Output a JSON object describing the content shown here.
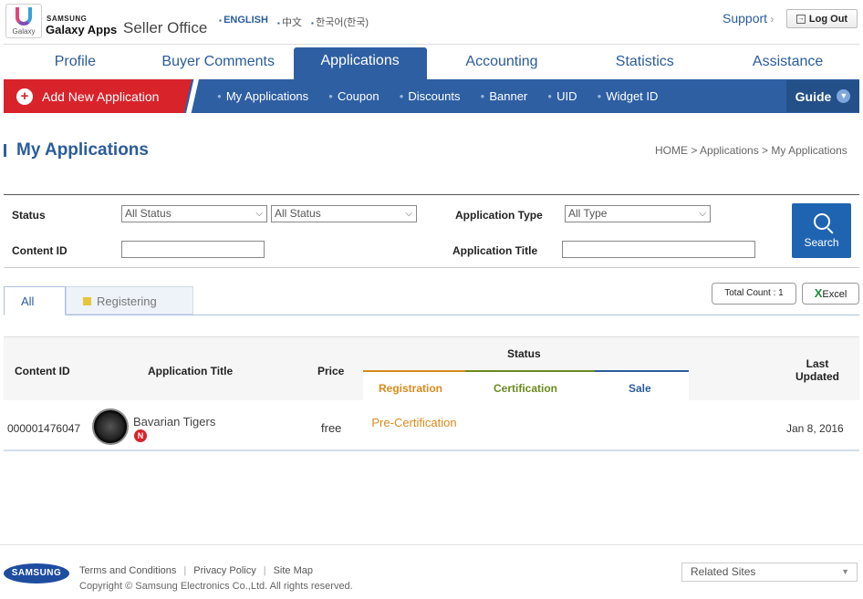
{
  "header": {
    "logo_text": "Galaxy",
    "brand_small": "SAMSUNG",
    "brand_big": "Galaxy Apps",
    "brand_office": "Seller Office",
    "languages": [
      "ENGLISH",
      "中文",
      "한국어(한국)"
    ],
    "support": "Support",
    "logout": "Log Out"
  },
  "main_nav": {
    "tabs": [
      "Profile",
      "Buyer Comments",
      "Applications",
      "Accounting",
      "Statistics",
      "Assistance"
    ],
    "active": "Applications"
  },
  "sub_nav": {
    "add_new": "Add New Application",
    "items": [
      "My Applications",
      "Coupon",
      "Discounts",
      "Banner",
      "UID",
      "Widget ID"
    ],
    "guide": "Guide"
  },
  "page": {
    "title": "My Applications",
    "breadcrumb": "HOME  >  Applications  >  My Applications"
  },
  "search": {
    "status_label": "Status",
    "status_select1": "All Status",
    "status_select2": "All Status",
    "app_type_label": "Application Type",
    "app_type_select": "All Type",
    "content_id_label": "Content ID",
    "content_id_value": "",
    "app_title_label": "Application Title",
    "app_title_value": "",
    "button": "Search"
  },
  "tabs": {
    "all": "All",
    "registering": "Registering",
    "total_count": "Total Count : 1",
    "excel": "Excel"
  },
  "table": {
    "headers": {
      "content_id": "Content ID",
      "app_title": "Application Title",
      "price": "Price",
      "status": "Status",
      "registration": "Registration",
      "certification": "Certification",
      "sale": "Sale",
      "last_updated_1": "Last",
      "last_updated_2": "Updated"
    },
    "rows": [
      {
        "content_id": "000001476047",
        "title": "Bavarian Tigers",
        "badge": "N",
        "price": "free",
        "registration": "Pre-Certification",
        "certification": "",
        "sale": "",
        "last_updated": "Jan 8, 2016"
      }
    ]
  },
  "footer": {
    "logo": "SAMSUNG",
    "links": [
      "Terms and Conditions",
      "Privacy Policy",
      "Site Map"
    ],
    "copyright": "Copyright © Samsung Electronics Co.,Ltd. All rights reserved.",
    "related_sites": "Related Sites"
  },
  "colors": {
    "primary_blue": "#2e5fa3",
    "add_red": "#d8232a",
    "registration_orange": "#d98a1c",
    "certification_green": "#6a8a1c",
    "sale_blue": "#2a5c9a"
  }
}
